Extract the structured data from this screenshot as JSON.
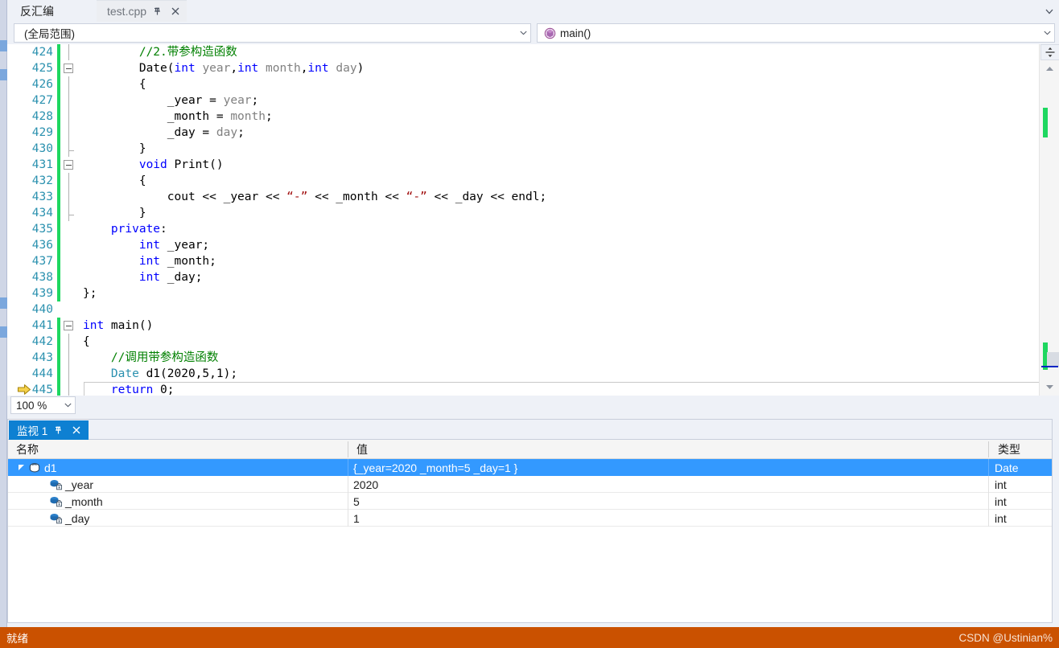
{
  "tabs": {
    "inactive": {
      "label": "反汇编"
    },
    "active": {
      "label": "test.cpp",
      "pin_icon": "pin-icon",
      "close_icon": "close-icon"
    },
    "overflow_icon": "chevron-down-icon"
  },
  "navbar": {
    "scope": {
      "value": "(全局范围)",
      "arrow_icon": "chevron-down-icon"
    },
    "member": {
      "value": "main()",
      "icon": "method-icon",
      "arrow_icon": "chevron-down-icon"
    }
  },
  "editor": {
    "zoom": {
      "value": "100 %",
      "arrow_icon": "chevron-down-icon"
    },
    "lines": [
      {
        "num": "424",
        "fold": "line",
        "changed": true,
        "current": false,
        "tokens": [
          {
            "t": "        ",
            "c": "pl"
          },
          {
            "t": "//2.带参构造函数",
            "c": "cm"
          }
        ]
      },
      {
        "num": "425",
        "fold": "box",
        "changed": true,
        "current": false,
        "tokens": [
          {
            "t": "        ",
            "c": "pl"
          },
          {
            "t": "Date",
            "c": "pl"
          },
          {
            "t": "(",
            "c": "pl"
          },
          {
            "t": "int",
            "c": "k"
          },
          {
            "t": " ",
            "c": "pl"
          },
          {
            "t": "year",
            "c": "pr"
          },
          {
            "t": ",",
            "c": "pl"
          },
          {
            "t": "int",
            "c": "k"
          },
          {
            "t": " ",
            "c": "pl"
          },
          {
            "t": "month",
            "c": "pr"
          },
          {
            "t": ",",
            "c": "pl"
          },
          {
            "t": "int",
            "c": "k"
          },
          {
            "t": " ",
            "c": "pl"
          },
          {
            "t": "day",
            "c": "pr"
          },
          {
            "t": ")",
            "c": "pl"
          }
        ]
      },
      {
        "num": "426",
        "fold": "line",
        "changed": true,
        "current": false,
        "tokens": [
          {
            "t": "        {",
            "c": "pl"
          }
        ]
      },
      {
        "num": "427",
        "fold": "line",
        "changed": true,
        "current": false,
        "tokens": [
          {
            "t": "            _year = ",
            "c": "pl"
          },
          {
            "t": "year",
            "c": "pr"
          },
          {
            "t": ";",
            "c": "pl"
          }
        ]
      },
      {
        "num": "428",
        "fold": "line",
        "changed": true,
        "current": false,
        "tokens": [
          {
            "t": "            _month = ",
            "c": "pl"
          },
          {
            "t": "month",
            "c": "pr"
          },
          {
            "t": ";",
            "c": "pl"
          }
        ]
      },
      {
        "num": "429",
        "fold": "line",
        "changed": true,
        "current": false,
        "tokens": [
          {
            "t": "            _day = ",
            "c": "pl"
          },
          {
            "t": "day",
            "c": "pr"
          },
          {
            "t": ";",
            "c": "pl"
          }
        ]
      },
      {
        "num": "430",
        "fold": "endcap",
        "changed": true,
        "current": false,
        "tokens": [
          {
            "t": "        }",
            "c": "pl"
          }
        ]
      },
      {
        "num": "431",
        "fold": "box",
        "changed": true,
        "current": false,
        "tokens": [
          {
            "t": "        ",
            "c": "pl"
          },
          {
            "t": "void",
            "c": "k"
          },
          {
            "t": " Print()",
            "c": "pl"
          }
        ]
      },
      {
        "num": "432",
        "fold": "line",
        "changed": true,
        "current": false,
        "tokens": [
          {
            "t": "        {",
            "c": "pl"
          }
        ]
      },
      {
        "num": "433",
        "fold": "line",
        "changed": true,
        "current": false,
        "tokens": [
          {
            "t": "            cout << _year << ",
            "c": "pl"
          },
          {
            "t": "“-”",
            "c": "st"
          },
          {
            "t": " << _month << ",
            "c": "pl"
          },
          {
            "t": "“-”",
            "c": "st"
          },
          {
            "t": " << _day << endl;",
            "c": "pl"
          }
        ]
      },
      {
        "num": "434",
        "fold": "endcap",
        "changed": true,
        "current": false,
        "tokens": [
          {
            "t": "        }",
            "c": "pl"
          }
        ]
      },
      {
        "num": "435",
        "fold": "none",
        "changed": true,
        "current": false,
        "tokens": [
          {
            "t": "    ",
            "c": "pl"
          },
          {
            "t": "private",
            "c": "k"
          },
          {
            "t": ":",
            "c": "pl"
          }
        ]
      },
      {
        "num": "436",
        "fold": "none",
        "changed": true,
        "current": false,
        "tokens": [
          {
            "t": "        ",
            "c": "pl"
          },
          {
            "t": "int",
            "c": "k"
          },
          {
            "t": " _year;",
            "c": "pl"
          }
        ]
      },
      {
        "num": "437",
        "fold": "none",
        "changed": true,
        "current": false,
        "tokens": [
          {
            "t": "        ",
            "c": "pl"
          },
          {
            "t": "int",
            "c": "k"
          },
          {
            "t": " _month;",
            "c": "pl"
          }
        ]
      },
      {
        "num": "438",
        "fold": "none",
        "changed": true,
        "current": false,
        "tokens": [
          {
            "t": "        ",
            "c": "pl"
          },
          {
            "t": "int",
            "c": "k"
          },
          {
            "t": " _day;",
            "c": "pl"
          }
        ]
      },
      {
        "num": "439",
        "fold": "none",
        "changed": true,
        "current": false,
        "tokens": [
          {
            "t": "};",
            "c": "pl"
          }
        ]
      },
      {
        "num": "440",
        "fold": "none",
        "changed": false,
        "current": false,
        "tokens": [
          {
            "t": "",
            "c": "pl"
          }
        ]
      },
      {
        "num": "441",
        "fold": "box",
        "changed": true,
        "current": false,
        "tokens": [
          {
            "t": "int",
            "c": "k"
          },
          {
            "t": " main()",
            "c": "pl"
          }
        ]
      },
      {
        "num": "442",
        "fold": "line",
        "changed": true,
        "current": false,
        "tokens": [
          {
            "t": "{",
            "c": "pl"
          }
        ]
      },
      {
        "num": "443",
        "fold": "line",
        "changed": true,
        "current": false,
        "tokens": [
          {
            "t": "    ",
            "c": "pl"
          },
          {
            "t": "//调用带参构造函数",
            "c": "cm"
          }
        ]
      },
      {
        "num": "444",
        "fold": "line",
        "changed": true,
        "current": false,
        "tokens": [
          {
            "t": "    ",
            "c": "pl"
          },
          {
            "t": "Date",
            "c": "ty"
          },
          {
            "t": " d1(2020,5,1);",
            "c": "pl"
          }
        ]
      },
      {
        "num": "445",
        "fold": "line",
        "changed": true,
        "current": true,
        "tokens": [
          {
            "t": "    ",
            "c": "pl"
          },
          {
            "t": "return",
            "c": "k"
          },
          {
            "t": " 0;",
            "c": "pl"
          }
        ]
      }
    ],
    "execution_marker_icon": "execution-pointer-arrow-icon",
    "scrollbar": {
      "split_icon": "split-view-icon",
      "up_icon": "scroll-up-arrow-icon",
      "down_icon": "scroll-down-arrow-icon"
    }
  },
  "watch": {
    "tab": {
      "label": "监视 1",
      "pin_icon": "pin-icon",
      "close_icon": "close-icon"
    },
    "columns": [
      "名称",
      "值",
      "类型"
    ],
    "rows": [
      {
        "name": "d1",
        "value": "{_year=2020 _month=5 _day=1 }",
        "type": "Date",
        "indent": 0,
        "expanded": true,
        "icon": "object-icon",
        "selected": true
      },
      {
        "name": "_year",
        "value": "2020",
        "type": "int",
        "indent": 1,
        "expanded": null,
        "icon": "private-field-icon",
        "selected": false
      },
      {
        "name": "_month",
        "value": "5",
        "type": "int",
        "indent": 1,
        "expanded": null,
        "icon": "private-field-icon",
        "selected": false
      },
      {
        "name": "_day",
        "value": "1",
        "type": "int",
        "indent": 1,
        "expanded": null,
        "icon": "private-field-icon",
        "selected": false
      }
    ]
  },
  "statusbar": {
    "text": "就绪",
    "watermark": "CSDN @Ustinian%",
    "color": "#ca5100"
  }
}
